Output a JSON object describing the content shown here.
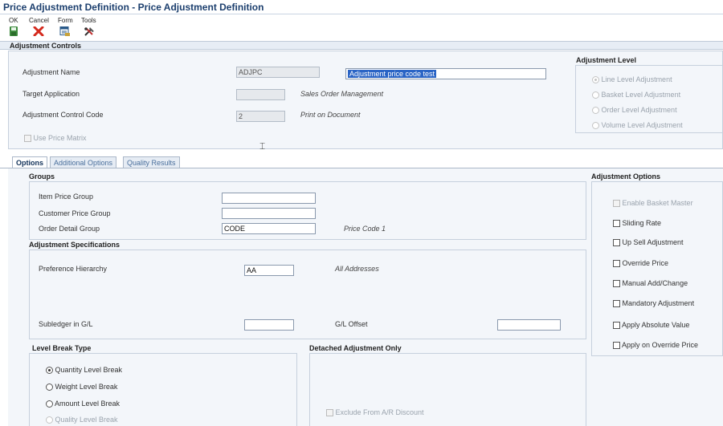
{
  "window": {
    "title": "Price Adjustment Definition - Price Adjustment Definition"
  },
  "toolbar": {
    "ok": {
      "label": "OK",
      "icon": "save-icon"
    },
    "cancel": {
      "label": "Cancel",
      "icon": "close-icon"
    },
    "form": {
      "label": "Form",
      "icon": "form-icon"
    },
    "tools": {
      "label": "Tools",
      "icon": "tools-icon"
    }
  },
  "adjustment_controls": {
    "header": "Adjustment Controls",
    "adjustment_name_label": "Adjustment Name",
    "adjustment_name_code": "ADJPC",
    "adjustment_name_desc": "Adjustment price code test",
    "target_application_label": "Target Application",
    "target_application_value": "",
    "target_application_desc": "Sales Order Management",
    "adjustment_control_code_label": "Adjustment Control Code",
    "adjustment_control_code_value": "2",
    "adjustment_control_code_desc": "Print on Document",
    "use_price_matrix_label": "Use Price Matrix"
  },
  "adjustment_level": {
    "header": "Adjustment Level",
    "options": [
      {
        "label": "Line Level Adjustment",
        "selected": true
      },
      {
        "label": "Basket Level Adjustment",
        "selected": false
      },
      {
        "label": "Order Level Adjustment",
        "selected": false
      },
      {
        "label": "Volume Level Adjustment",
        "selected": false
      }
    ]
  },
  "tabs": [
    {
      "label": "Options",
      "active": true
    },
    {
      "label": "Additional Options",
      "active": false
    },
    {
      "label": "Quality Results",
      "active": false
    }
  ],
  "groups": {
    "header": "Groups",
    "item_price_group_label": "Item Price Group",
    "item_price_group_value": "",
    "customer_price_group_label": "Customer Price Group",
    "customer_price_group_value": "",
    "order_detail_group_label": "Order Detail Group",
    "order_detail_group_value": "CODE",
    "order_detail_group_desc": "Price Code 1"
  },
  "adjustment_specifications": {
    "header": "Adjustment Specifications",
    "preference_hierarchy_label": "Preference Hierarchy",
    "preference_hierarchy_value": "AA",
    "preference_hierarchy_desc": "All Addresses",
    "subledger_label": "Subledger in G/L",
    "subledger_value": "",
    "gl_offset_label": "G/L Offset",
    "gl_offset_value": ""
  },
  "level_break_type": {
    "header": "Level Break Type",
    "options": [
      {
        "label": "Quantity Level Break",
        "selected": true,
        "disabled": false
      },
      {
        "label": "Weight Level Break",
        "selected": false,
        "disabled": false
      },
      {
        "label": "Amount Level Break",
        "selected": false,
        "disabled": false
      },
      {
        "label": "Quality Level Break",
        "selected": false,
        "disabled": true
      }
    ]
  },
  "detached_adjustment": {
    "header": "Detached Adjustment Only",
    "exclude_label": "Exclude From A/R Discount"
  },
  "adjustment_options": {
    "header": "Adjustment Options",
    "items": [
      {
        "label": "Enable Basket Master",
        "checked": false,
        "disabled": true
      },
      {
        "label": "Sliding Rate",
        "checked": false,
        "disabled": false
      },
      {
        "label": "Up Sell Adjustment",
        "checked": false,
        "disabled": false
      },
      {
        "label": "Override Price",
        "checked": false,
        "disabled": false
      },
      {
        "label": "Manual Add/Change",
        "checked": false,
        "disabled": false
      },
      {
        "label": "Mandatory Adjustment",
        "checked": false,
        "disabled": false
      },
      {
        "label": "Apply Absolute Value",
        "checked": false,
        "disabled": false
      },
      {
        "label": "Apply on Override Price",
        "checked": false,
        "disabled": false
      }
    ]
  }
}
